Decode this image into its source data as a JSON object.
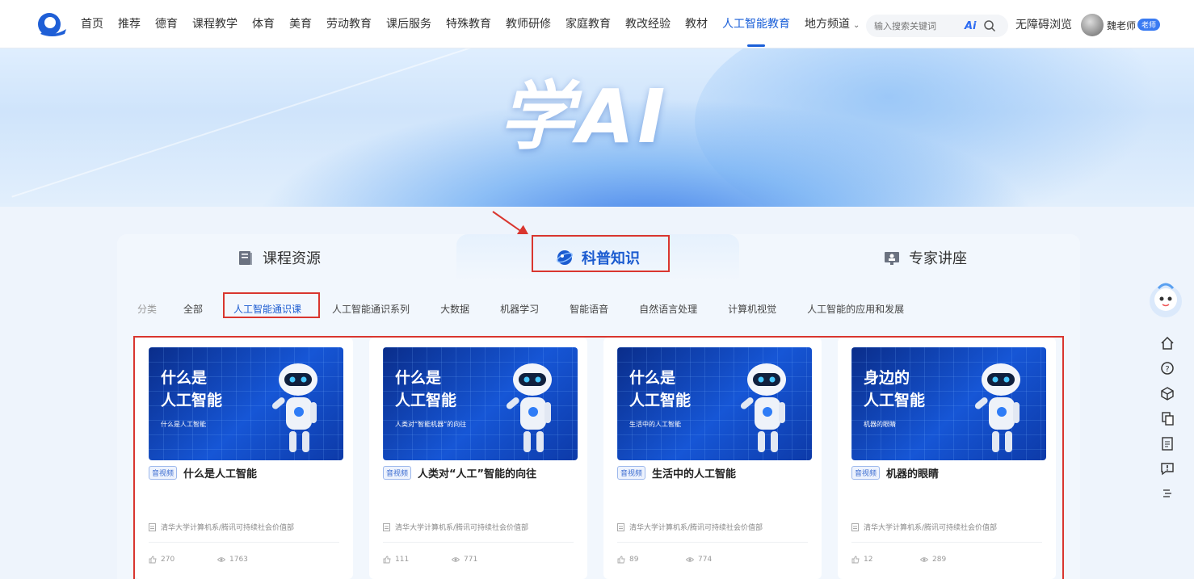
{
  "nav": {
    "items": [
      "首页",
      "推荐",
      "德育",
      "课程教学",
      "体育",
      "美育",
      "劳动教育",
      "课后服务",
      "特殊教育",
      "教师研修",
      "家庭教育",
      "教改经验",
      "教材",
      "人工智能教育"
    ],
    "dropdown_label": "地方频道",
    "active_index": 13,
    "search_placeholder": "输入搜索关键词",
    "ai_label": "Ai",
    "accessibility": "无障碍浏览",
    "username": "魏老师",
    "role_badge": "老师"
  },
  "banner": {
    "title": "学AI"
  },
  "tabs": [
    {
      "label": "课程资源",
      "icon": "book-icon"
    },
    {
      "label": "科普知识",
      "icon": "globe-icon"
    },
    {
      "label": "专家讲座",
      "icon": "lecture-icon"
    }
  ],
  "categories": {
    "label": "分类",
    "items": [
      "全部",
      "人工智能通识课",
      "人工智能通识系列",
      "大数据",
      "机器学习",
      "智能语音",
      "自然语言处理",
      "计算机视觉",
      "人工智能的应用和发展"
    ],
    "active_index": 1
  },
  "cards": [
    {
      "thumb_title_1": "什么是",
      "thumb_title_2": "人工智能",
      "thumb_sub": "什么是人工智能",
      "tag": "音视频",
      "title": "什么是人工智能",
      "source": "清华大学计算机系/腾讯可持续社会价值部",
      "likes": "270",
      "views": "1763"
    },
    {
      "thumb_title_1": "什么是",
      "thumb_title_2": "人工智能",
      "thumb_sub": "人类对“智能机器”的向往",
      "tag": "音视频",
      "title": "人类对“人工”智能的向往",
      "source": "清华大学计算机系/腾讯可持续社会价值部",
      "likes": "111",
      "views": "771"
    },
    {
      "thumb_title_1": "什么是",
      "thumb_title_2": "人工智能",
      "thumb_sub": "生活中的人工智能",
      "tag": "音视频",
      "title": "生活中的人工智能",
      "source": "清华大学计算机系/腾讯可持续社会价值部",
      "likes": "89",
      "views": "774"
    },
    {
      "thumb_title_1": "身边的",
      "thumb_title_2": "人工智能",
      "thumb_sub": "机器的眼睛",
      "tag": "音视频",
      "title": "机器的眼睛",
      "source": "清华大学计算机系/腾讯可持续社会价值部",
      "likes": "12",
      "views": "289"
    }
  ],
  "side_tools": [
    "home-icon",
    "help-icon",
    "cube-icon",
    "copy-icon",
    "document-icon",
    "feedback-icon",
    "menu-icon"
  ],
  "colors": {
    "accent": "#1b5bd0",
    "annotation_red": "#d9362f"
  }
}
